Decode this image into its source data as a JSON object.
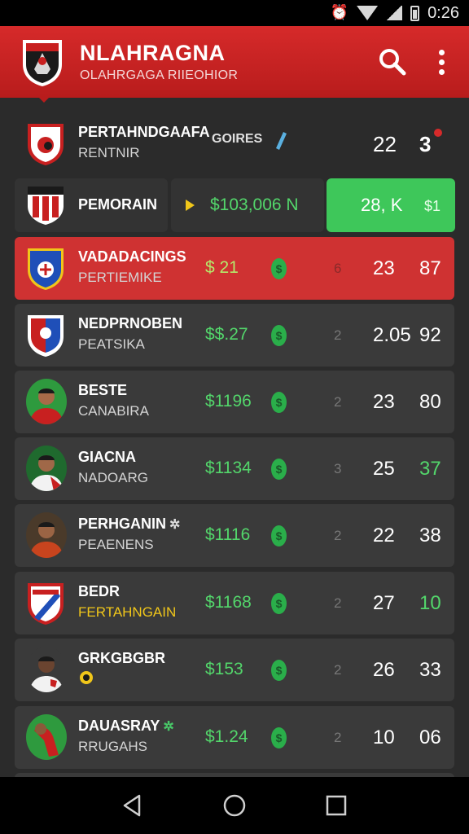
{
  "status_bar": {
    "time": "0:26",
    "icons": [
      "alarm-icon",
      "wifi-icon",
      "signal-icon",
      "battery-icon"
    ]
  },
  "app_bar": {
    "title": "NLAHRAGNA",
    "subtitle": "OLAHRGAGA RIIEOHIOR",
    "actions": [
      "search-icon",
      "overflow-menu-icon"
    ],
    "color": "#d62a2a"
  },
  "header_row": {
    "name": "PERTAHNDGAAFA",
    "sub": "RENTNIR",
    "tag": "GOIRES",
    "stat1": "22",
    "stat2": "3"
  },
  "featured": {
    "name": "PEMORAIN",
    "price": "$103,006 N",
    "btn_value": "28, K",
    "btn_suffix": "$1"
  },
  "rows": [
    {
      "name": "VADADACINGS",
      "sub": "PERTIEMIKE",
      "price": "$ 21",
      "small": "6",
      "stat1": "23",
      "stat2": "87",
      "highlight": true,
      "icon": "crest-blue"
    },
    {
      "name": "NEDPRNOBEN",
      "sub": "PEATSIKA",
      "price": "$$.27",
      "small": "2",
      "stat1": "2.05",
      "stat2": "92",
      "icon": "crest-red-blue"
    },
    {
      "name": "BESTE",
      "sub": "CANABIRA",
      "price": "$1196",
      "small": "2",
      "stat1": "23",
      "stat2": "80",
      "icon": "player-avatar"
    },
    {
      "name": "GIACNA",
      "sub": "NADOARG",
      "price": "$1134",
      "small": "3",
      "stat1": "25",
      "stat2": "37",
      "stat2_green": true,
      "icon": "player-avatar"
    },
    {
      "name": "PERHGANIN",
      "sub": "PEAENENS",
      "price": "$1116",
      "small": "2",
      "stat1": "22",
      "stat2": "38",
      "icon": "player-avatar",
      "mark": "✲"
    },
    {
      "name": "BEDR",
      "sub": "FERTAHNGAIN",
      "price": "$1168",
      "small": "2",
      "stat1": "27",
      "stat2": "10",
      "stat2_green": true,
      "sub_yellow": true,
      "icon": "crest-red-blue"
    },
    {
      "name": "GRKGBGBR",
      "sub": "",
      "price": "$153",
      "small": "2",
      "stat1": "26",
      "stat2": "33",
      "icon": "player-avatar"
    },
    {
      "name": "DAUASRAY",
      "sub": "RRUGAHS",
      "price": "$1.24",
      "small": "2",
      "stat1": "10",
      "stat2": "06",
      "icon": "player-avatar",
      "mark": "✲"
    }
  ],
  "nav_bar": {
    "buttons": [
      "back-icon",
      "home-icon",
      "recents-icon"
    ]
  }
}
